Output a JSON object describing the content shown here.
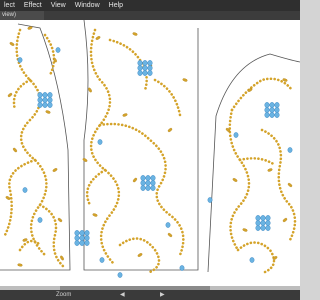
{
  "menu": {
    "items": [
      "lect",
      "Effect",
      "View",
      "Window",
      "Help"
    ]
  },
  "document": {
    "tab_label": "view)"
  },
  "statusbar": {
    "zoom_label": "Zoom",
    "nav_prev": "◀",
    "nav_next": "▶"
  },
  "colors": {
    "bead_gold": "#d4a32a",
    "bead_gold_dark": "#a87a17",
    "bead_blue": "#6ab3e2",
    "bead_blue_dark": "#3b84bf",
    "outline": "#555555"
  },
  "canvas": {
    "content": "embroidery pattern artwork: jacket front panels and sleeve with gold bead vines and blue bead flowers"
  }
}
